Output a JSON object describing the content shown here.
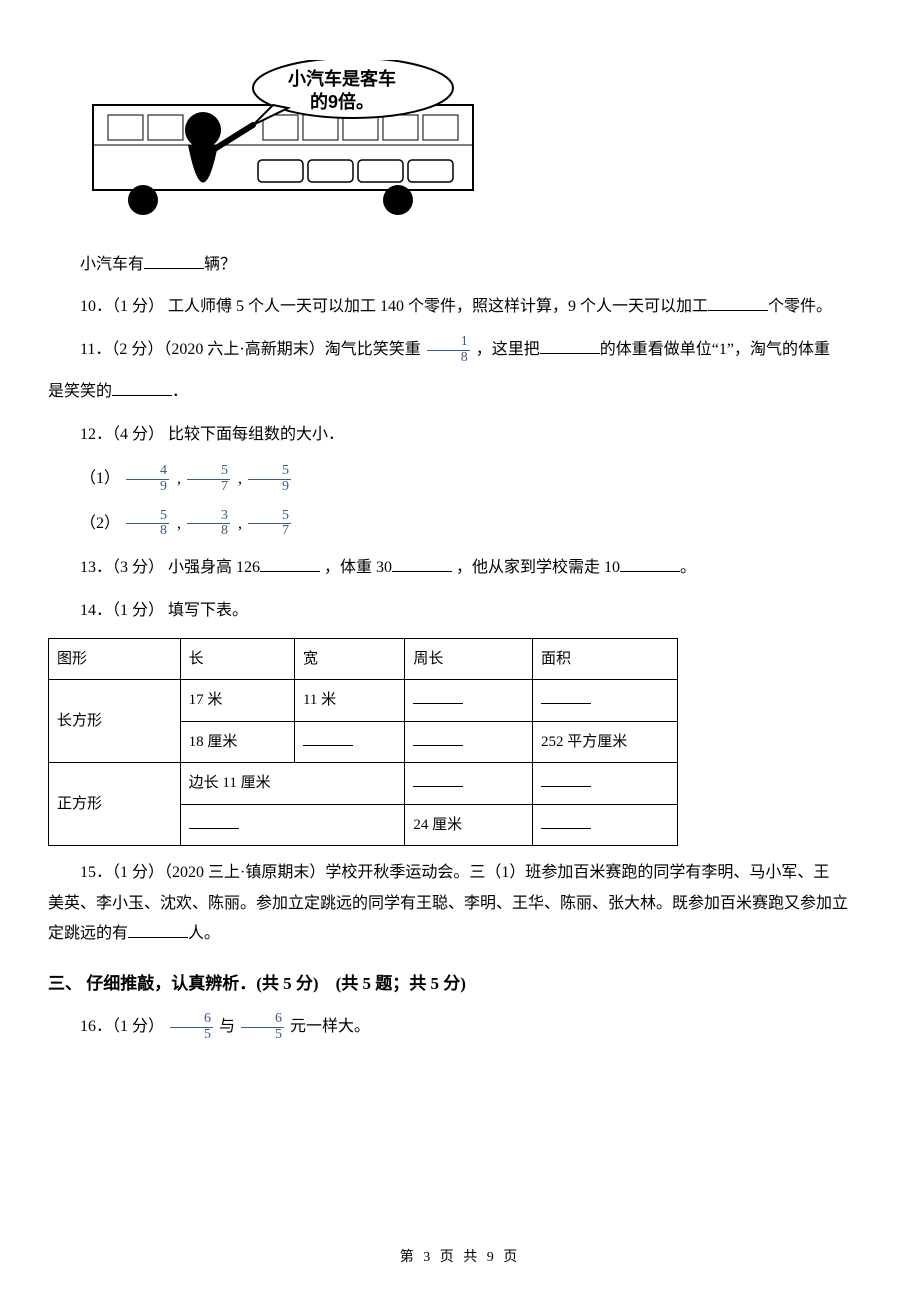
{
  "illustration": {
    "bubble_line1": "小汽车是客车",
    "bubble_line2": "的9倍。"
  },
  "q9_tail": {
    "prefix": "小汽车有",
    "suffix": "辆？"
  },
  "q10": {
    "label": "10．（1 分） 工人师傅 5 个人一天可以加工 140 个零件，照这样计算，9 个人一天可以加工",
    "suffix": "个零件。"
  },
  "q11": {
    "label_a": "11．（2 分）（2020 六上·高新期末）淘气比笑笑重 ",
    "frac": {
      "num": "1",
      "den": "8"
    },
    "label_b": " ，这里把",
    "label_c": "的体重看做单位“1”，淘气的体重",
    "line2_a": "是笑笑的",
    "line2_b": "．"
  },
  "q12": {
    "label": "12．（4 分） 比较下面每组数的大小．",
    "row1_label": "（1）",
    "row1": [
      {
        "num": "4",
        "den": "9"
      },
      {
        "num": "5",
        "den": "7"
      },
      {
        "num": "5",
        "den": "9"
      }
    ],
    "row2_label": "（2）",
    "row2": [
      {
        "num": "5",
        "den": "8"
      },
      {
        "num": "3",
        "den": "8"
      },
      {
        "num": "5",
        "den": "7"
      }
    ]
  },
  "q13": {
    "a": "13．（3 分） 小强身高 126",
    "b": "，体重 30",
    "c": "，他从家到学校需走 10",
    "d": "。"
  },
  "q14": {
    "label": "14．（1 分） 填写下表。",
    "headers": {
      "c1": "图形",
      "c2": "长",
      "c3": "宽",
      "c4": "周长",
      "c5": "面积"
    },
    "r1": {
      "c1": "长方形",
      "c2": "17 米",
      "c3": "11 米"
    },
    "r2": {
      "c2": "18 厘米",
      "c5": "252 平方厘米"
    },
    "r3": {
      "c1": "正方形",
      "c2": "边长 11 厘米"
    },
    "r4": {
      "c4": "24 厘米"
    }
  },
  "q15": {
    "a": "15．（1 分）（2020 三上·镇原期末）学校开秋季运动会。三（1）班参加百米赛跑的同学有李明、马小军、王",
    "b": "美英、李小玉、沈欢、陈丽。参加立定跳远的同学有王聪、李明、王华、陈丽、张大林。既参加百米赛跑又参加立",
    "c_a": "定跳远的有",
    "c_b": "人。"
  },
  "section3": "三、 仔细推敲，认真辨析．(共 5 分)　(共 5 题；共 5 分)",
  "q16": {
    "a": "16．（1 分） ",
    "frac1": {
      "num": "6",
      "den": "5"
    },
    "mid": " 与 ",
    "frac2": {
      "num": "6",
      "den": "5"
    },
    "b": " 元一样大。"
  },
  "footer": "第 3 页 共 9 页"
}
